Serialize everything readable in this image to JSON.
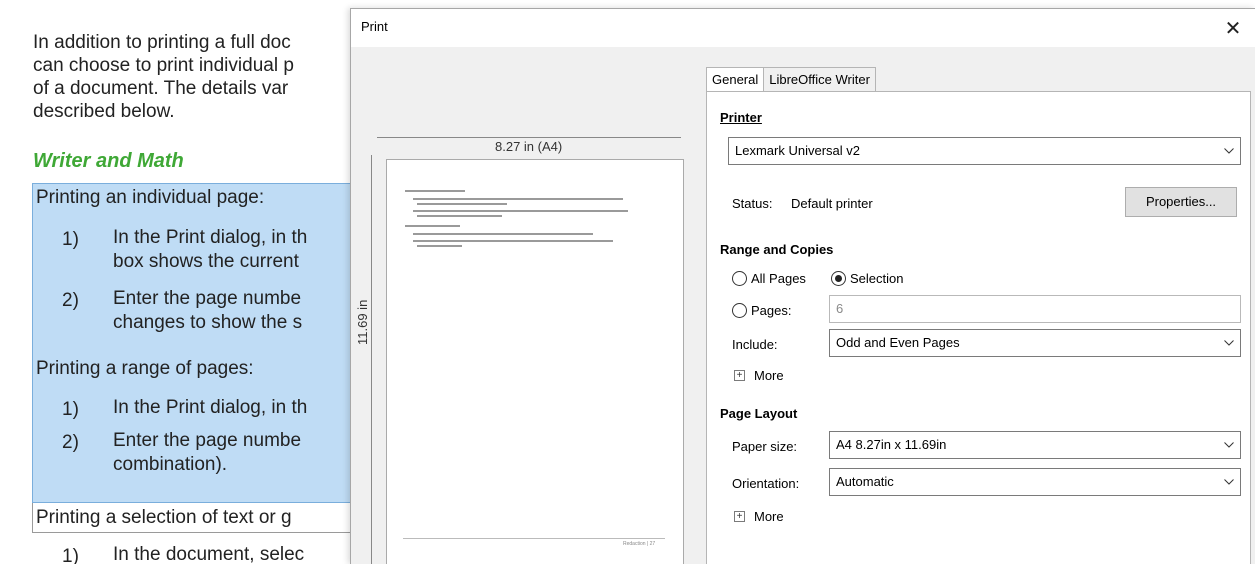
{
  "document": {
    "intro_lines": [
      "In addition to printing a full doc",
      "can choose to print individual p",
      "of a document. The details var",
      "described below."
    ],
    "heading": "Writer and Math",
    "para1": "Printing an individual page:",
    "list1": [
      {
        "num": "1)",
        "lines": [
          "In the Print dialog, in th",
          "box shows the current"
        ]
      },
      {
        "num": "2)",
        "lines": [
          "Enter the page numbe",
          "changes to show the s"
        ]
      }
    ],
    "para2": "Printing a range of pages:",
    "list2": [
      {
        "num": "1)",
        "lines": [
          "In the Print dialog, in th"
        ]
      },
      {
        "num": "2)",
        "lines": [
          "Enter the page numbe",
          "combination)."
        ]
      }
    ],
    "para3": "Printing a selection of text or g",
    "list3": [
      {
        "num": "1)",
        "lines": [
          "In the document, selec"
        ]
      }
    ]
  },
  "dialog": {
    "title": "Print",
    "close_glyph": "✕",
    "preview": {
      "width_label": "8.27 in (A4)",
      "height_label": "11.69 in",
      "footer_text": "Redaction | 27"
    },
    "tabs": [
      {
        "label": "General",
        "active": true
      },
      {
        "label": "LibreOffice Writer",
        "active": false
      }
    ],
    "printer": {
      "section_label": "Printer",
      "selected": "Lexmark Universal v2",
      "status_label": "Status:",
      "status_value": "Default printer",
      "properties_label": "Properties..."
    },
    "range": {
      "section_label": "Range and Copies",
      "all_pages_label": "All Pages",
      "selection_label": "Selection",
      "pages_label": "Pages:",
      "pages_value": "6",
      "include_label": "Include:",
      "include_value": "Odd and Even Pages",
      "more_label": "More",
      "selected_option": "Selection"
    },
    "layout": {
      "section_label": "Page Layout",
      "paper_size_label": "Paper size:",
      "paper_size_value": "A4 8.27in x 11.69in",
      "orientation_label": "Orientation:",
      "orientation_value": "Automatic",
      "more_label": "More"
    }
  }
}
